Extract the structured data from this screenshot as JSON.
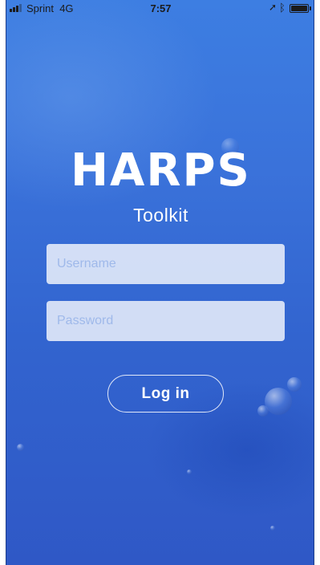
{
  "status_bar": {
    "carrier": "Sprint",
    "network": "4G",
    "time": "7:57",
    "icons": [
      "signal-bars-icon",
      "location-arrow-icon",
      "bluetooth-icon",
      "battery-icon"
    ]
  },
  "app": {
    "logo_text": "HARPS",
    "subtitle": "Toolkit"
  },
  "login_form": {
    "username_placeholder": "Username",
    "username_value": "",
    "password_placeholder": "Password",
    "password_value": "",
    "login_button_label": "Log in"
  },
  "colors": {
    "background_top": "#3d7ee2",
    "background_bottom": "#2f58c6",
    "text": "#ffffff",
    "placeholder": "#9fb9ea"
  }
}
